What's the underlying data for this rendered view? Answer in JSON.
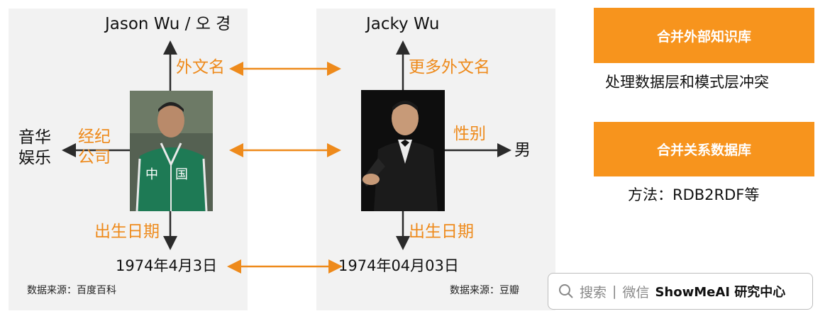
{
  "left": {
    "top_name": "Jason Wu / 오 경",
    "rel_foreign_name": "外文名",
    "rel_company_line1": "经纪",
    "rel_company_line2": "公司",
    "company_line1": "音华",
    "company_line2": "娱乐",
    "rel_birth": "出生日期",
    "birth_value": "1974年4月3日",
    "source": "数据来源：百度百科"
  },
  "right": {
    "top_name": "Jacky Wu",
    "rel_more_foreign_names": "更多外文名",
    "rel_gender": "性别",
    "gender_value": "男",
    "rel_birth": "出生日期",
    "birth_value": "1974年04月03日",
    "source": "数据来源：豆瓣"
  },
  "side": {
    "merge_kb_label": "合并外部知识库",
    "merge_kb_desc": "处理数据层和模式层冲突",
    "merge_db_label": "合并关系数据库",
    "merge_db_desc": "方法：RDB2RDF等"
  },
  "watermark": {
    "search_icon": "search-icon",
    "text_search": "搜索",
    "separator": "|",
    "text_wechat": "微信",
    "brand": "ShowMeAI 研究中心"
  },
  "colors": {
    "accent_orange": "#f7941d",
    "label_orange": "#ee8a1b",
    "panel_gray": "#f2f2f2"
  }
}
